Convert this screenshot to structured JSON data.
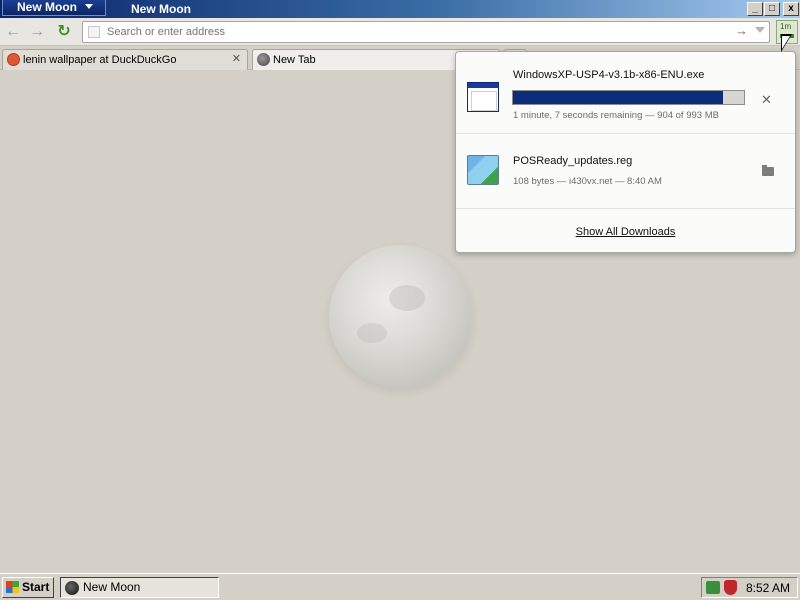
{
  "window": {
    "app_menu_label": "New Moon",
    "title": "New Moon",
    "minimize": "_",
    "maximize": "□",
    "close": "x"
  },
  "navbar": {
    "back_glyph": "←",
    "forward_glyph": "→",
    "reload_glyph": "↻",
    "address_value": "",
    "address_placeholder": "Search or enter address",
    "go_glyph": "→",
    "downloads_time": "1m",
    "icons": [
      "back-icon",
      "forward-icon",
      "reload-icon",
      "page-icon",
      "go-arrow-icon",
      "dropdown-arrow-icon",
      "downloads-icon"
    ]
  },
  "tabs": [
    {
      "label": "lenin wallpaper at DuckDuckGo",
      "close": "✕",
      "icon": "duckduckgo-favicon"
    },
    {
      "label": "New Tab",
      "icon": "globe-icon"
    }
  ],
  "downloads": {
    "items": [
      {
        "name": "WindowsXP-USP4-v3.1b-x86-ENU.exe",
        "status": "1 minute, 7 seconds remaining — 904 of 993 MB",
        "progress_fraction": 0.91,
        "action_glyph": "✕",
        "icon": "exe-file-icon"
      },
      {
        "name": "POSReady_updates.reg",
        "status": "108 bytes — i430vx.net — 8:40 AM",
        "icon": "registry-file-icon"
      }
    ],
    "show_all_label": "Show All Downloads"
  },
  "taskbar": {
    "start_label": "Start",
    "task_label": "New Moon",
    "clock": "8:52 AM"
  },
  "colors": {
    "title_gradient_start": "#0a246a",
    "progress_fill": "#0b2d7a",
    "page_background": "#d4d0c8"
  }
}
